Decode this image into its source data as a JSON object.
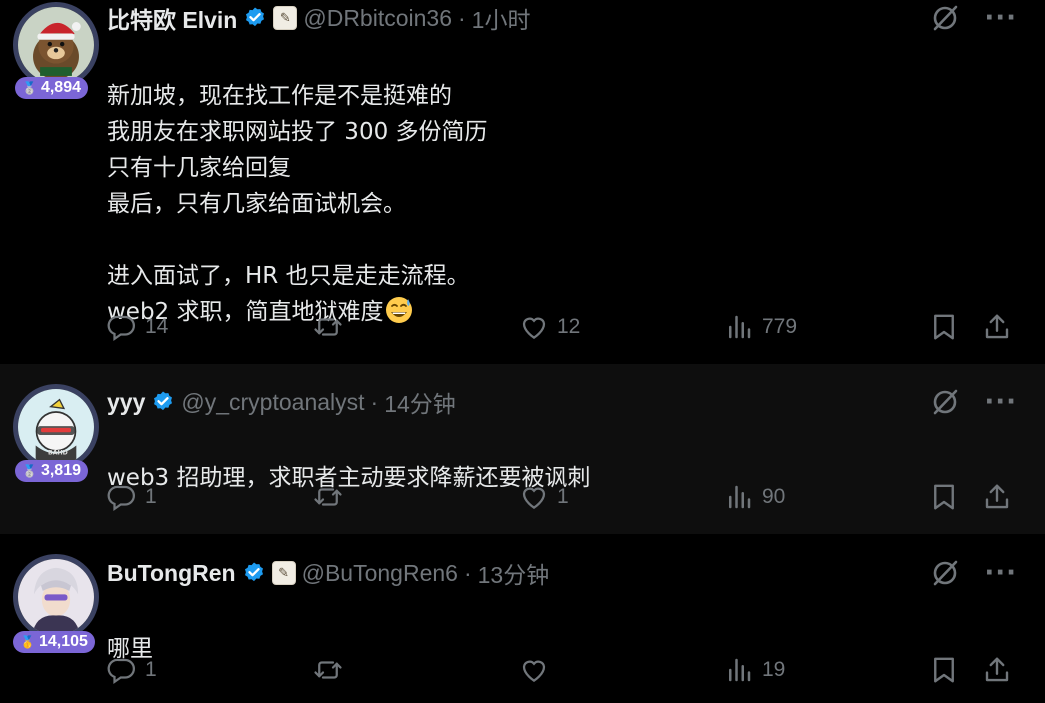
{
  "posts": [
    {
      "name": "比特欧 Elvin",
      "handle": "@DRbitcoin36",
      "separator": "·",
      "time": "1小时",
      "badge_count": "4,894",
      "text": "新加坡，现在找工作是不是挺难的\n我朋友在求职网站投了 300 多份简历\n只有十几家给回复\n最后，只有几家给面试机会。\n\n进入面试了，HR 也只是走走流程。\nweb2 求职，简直地狱难度",
      "emoji": "grinning-face-with-sweat",
      "replies": "14",
      "reposts": "",
      "likes": "12",
      "views": "779",
      "affiliation_icon": "scroll-badge-icon"
    },
    {
      "name": "yyy",
      "handle": "@y_cryptoanalyst",
      "separator": "·",
      "time": "14分钟",
      "badge_count": "3,819",
      "text": "web3 招助理，求职者主动要求降薪还要被讽刺",
      "replies": "1",
      "reposts": "",
      "likes": "1",
      "views": "90"
    },
    {
      "name": "BuTongRen",
      "handle": "@BuTongRen6",
      "separator": "·",
      "time": "13分钟",
      "badge_count": "14,105",
      "text": "哪里",
      "replies": "1",
      "reposts": "",
      "likes": "",
      "views": "19",
      "affiliation_icon": "scroll-badge-icon"
    }
  ],
  "colors": {
    "background": "#000000",
    "alt_background": "#0e0e0e",
    "text": "#e7e9ea",
    "muted": "#71767b",
    "verified": "#1d9bf0",
    "badge": "#7b66d6",
    "thread_line": "#333639"
  },
  "icons": {
    "reply": "reply-icon",
    "repost": "repost-icon",
    "like": "like-icon",
    "views": "views-icon",
    "bookmark": "bookmark-icon",
    "share": "share-icon",
    "grok": "grok-icon",
    "more": "more-icon",
    "verified": "verified-icon"
  }
}
